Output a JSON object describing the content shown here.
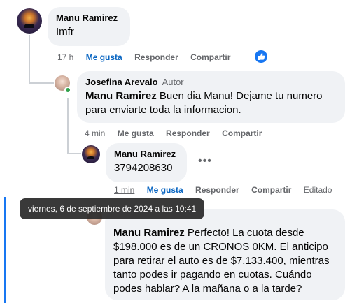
{
  "comments": [
    {
      "author": "Manu Ramirez",
      "text": "Imfr",
      "time": "17 h",
      "like_label": "Me gusta",
      "reply_label": "Responder",
      "share_label": "Compartir",
      "reaction_icon": "thumbs-up-icon",
      "liked": true
    },
    {
      "author": "Josefina Arevalo",
      "badge": "Autor",
      "mention": "Manu Ramirez",
      "text": " Buen dia Manu! Dejame tu numero para enviarte toda la informacion.",
      "time": "4 min",
      "like_label": "Me gusta",
      "reply_label": "Responder",
      "share_label": "Compartir",
      "online": true
    },
    {
      "author": "Manu Ramirez",
      "text": "3794208630",
      "time": "1 min",
      "like_label": "Me gusta",
      "reply_label": "Responder",
      "share_label": "Compartir",
      "edited_label": "Editado",
      "more_icon": "more-options-icon",
      "liked": true
    },
    {
      "author": "Josefina Arevalo",
      "mention": "Manu Ramirez",
      "text": " Perfecto! La cuota desde $198.000 es de un CRONOS 0KM. El anticipo para retirar el auto es de $7.133.400, mientras tanto podes ir pagando en cuotas. Cuándo podes hablar? A la mañana o a la tarde?"
    }
  ],
  "tooltip": {
    "text": "viernes, 6 de septiembre de 2024 a las 10:41"
  },
  "colors": {
    "accent": "#1877f2",
    "link": "#0a66c2",
    "bubble": "#f0f2f5",
    "muted": "#65676b",
    "online": "#31a24c"
  }
}
